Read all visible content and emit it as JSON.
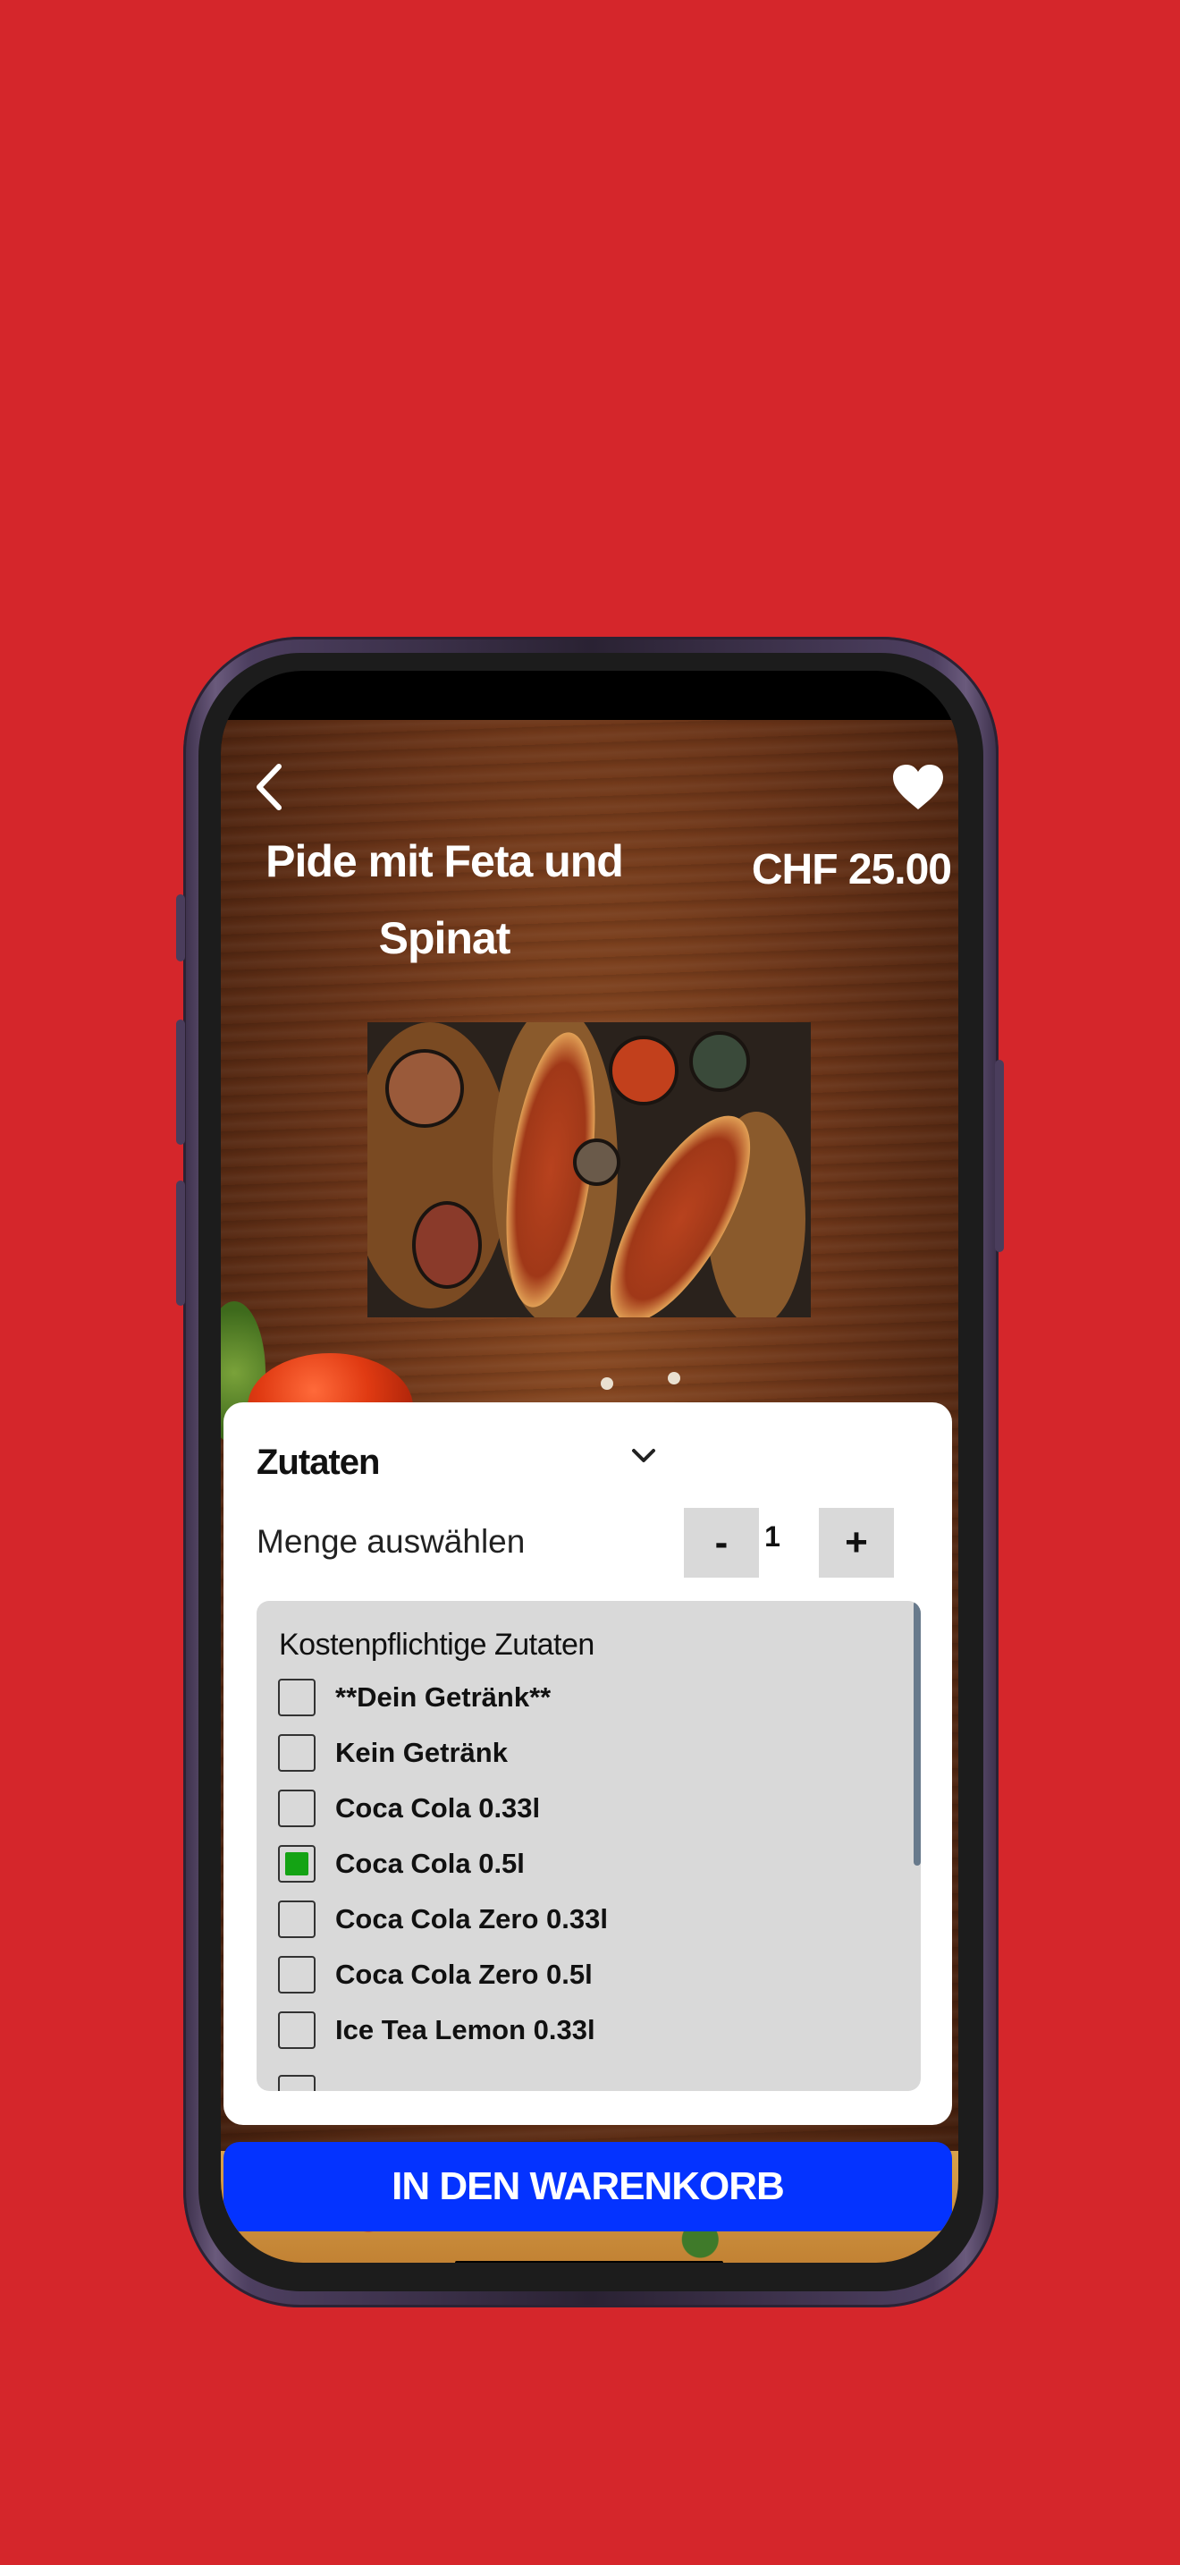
{
  "product": {
    "title": "Pide mit Feta und Spinat",
    "price": "CHF 25.00",
    "image_alt": "Pide food image"
  },
  "sheet": {
    "section_title": "Zutaten",
    "quantity_label": "Menge auswählen",
    "quantity_value": "1",
    "minus_label": "-",
    "plus_label": "+",
    "list_title": "Kostenpflichtige Zutaten",
    "options": [
      {
        "label": "**Dein Getränk**",
        "checked": false
      },
      {
        "label": "Kein Getränk",
        "checked": false
      },
      {
        "label": "Coca Cola 0.33l",
        "checked": false
      },
      {
        "label": "Coca Cola 0.5l",
        "checked": true
      },
      {
        "label": "Coca Cola Zero 0.33l",
        "checked": false
      },
      {
        "label": "Coca Cola Zero 0.5l",
        "checked": false
      },
      {
        "label": "Ice Tea Lemon 0.33l",
        "checked": false
      }
    ]
  },
  "cart_button": "IN DEN WARENKORB",
  "icons": {
    "back": "chevron-left-icon",
    "favorite": "heart-icon",
    "expand": "chevron-down-icon"
  },
  "colors": {
    "background": "#d5262b",
    "cart_button": "#0433ff",
    "checked": "#14a314"
  }
}
